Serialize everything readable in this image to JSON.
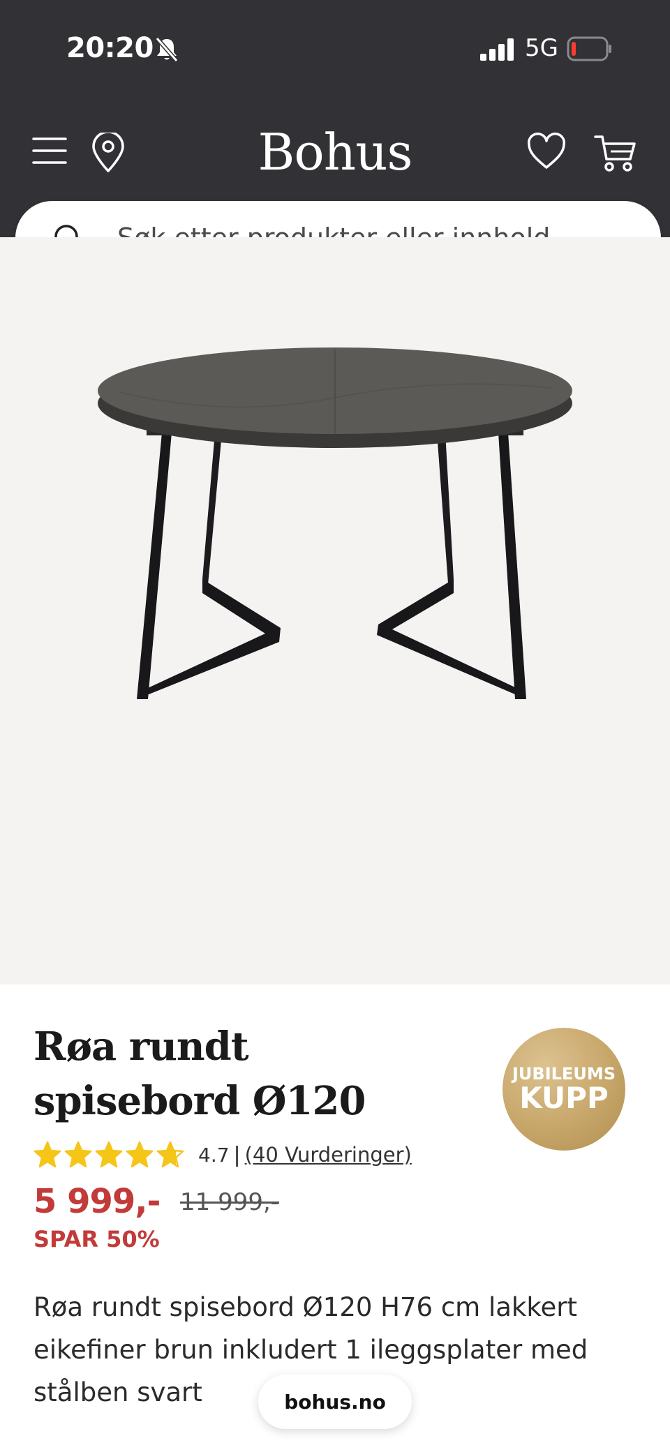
{
  "status_bar": {
    "time": "20:20",
    "network": "5G"
  },
  "header": {
    "logo": "Bohus",
    "icons": [
      "menu-icon",
      "location-pin-icon",
      "heart-icon",
      "cart-icon"
    ],
    "background_color": "#323236"
  },
  "search": {
    "placeholder": "Søk etter produkter eller innhold..."
  },
  "gallery": {
    "thumbnails": [
      "table-product",
      "dining-scene-1",
      "dining-scene-2",
      "dining-scene-3",
      "table-extended",
      "table-top-closeup"
    ],
    "active_thumbnail": 0
  },
  "product": {
    "title": "Røa rundt spisebord Ø120",
    "badge_top": "JUBILEUMS",
    "badge_bottom": "KUPP",
    "rating_value": "4.7",
    "rating_separator": "|",
    "rating_stars": 4.7,
    "rating_link": "(40 Vurderinger)",
    "price": "5 999,-",
    "old_price": "11 999,-",
    "saving": "SPAR 50%",
    "description": "Røa rundt spisebord Ø120 H76 cm lakkert eikefiner brun inkludert 1 ileggsplater med stålben svart",
    "price_color": "#c23a39",
    "star_color": "#f5c518"
  },
  "browser": {
    "url": "bohus.no"
  }
}
